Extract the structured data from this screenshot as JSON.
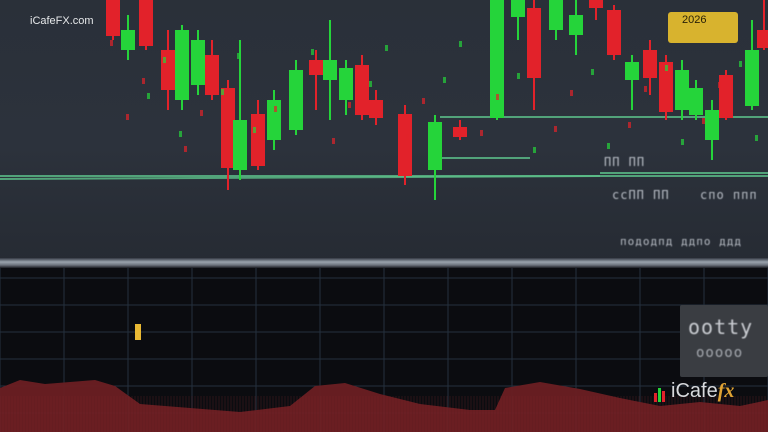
{
  "watermark": {
    "brand_text": "iCafeFX.com"
  },
  "year_badge": {
    "label": "2026"
  },
  "chart_labels": {
    "row1": "ПП ПП",
    "row2": "ссПП ПП",
    "row3": "спо ппп",
    "row4": "пододпд ддпо ддд"
  },
  "side_panel": {
    "line1": "ootty",
    "line2": "ооооо"
  },
  "logo": {
    "name": "iCafe",
    "suffix": "fx"
  },
  "colors": {
    "up_candle": "#25d43a",
    "down_candle": "#e2222a",
    "level_line": "#5cc08a",
    "oscillator_fill": "#6b1f23",
    "grid": "#24303e"
  }
}
